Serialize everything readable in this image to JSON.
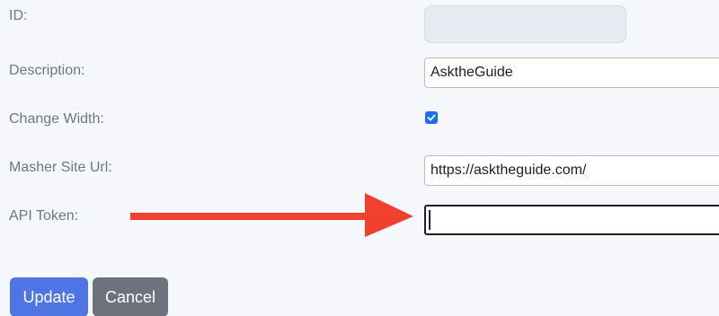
{
  "form": {
    "id": {
      "label": "ID:",
      "value": ""
    },
    "description": {
      "label": "Description:",
      "value": "AsktheGuide"
    },
    "change_width": {
      "label": "Change Width:",
      "checked": true
    },
    "masher_site_url": {
      "label": "Masher Site Url:",
      "value": "https://asktheguide.com/"
    },
    "api_token": {
      "label": "API Token:",
      "value": ""
    }
  },
  "actions": {
    "update_label": "Update",
    "cancel_label": "Cancel"
  },
  "annotation": {
    "icon": "arrow-right-icon",
    "color": "#f2402f"
  },
  "colors": {
    "primary": "#4f74e3",
    "secondary": "#6c737d",
    "checkbox": "#1a6ff5"
  }
}
